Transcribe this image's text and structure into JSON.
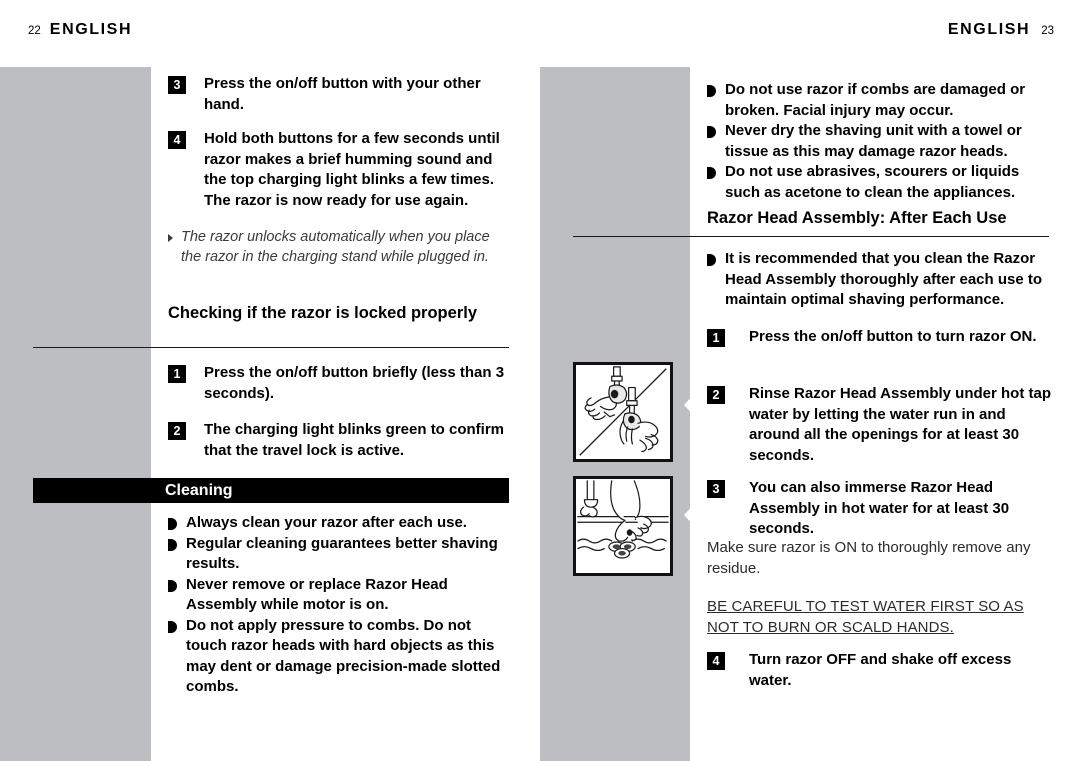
{
  "document": {
    "type": "product-manual-spread",
    "colors": {
      "page_background": "#ffffff",
      "side_column_gray": "#bcbec2",
      "section_bar": "#000000",
      "text": "#000000",
      "secondary_text": "#2b2b2b"
    }
  },
  "left_page": {
    "running_head": {
      "folio": "22",
      "language": "ENGLISH"
    },
    "steps_continued": [
      {
        "number": "3",
        "text": "Press the on/off button with your other hand."
      },
      {
        "number": "4",
        "text": "Hold both buttons for a few seconds until razor makes a brief humming sound and the top charging light blinks a few times. The razor is now ready for use again."
      }
    ],
    "note": "The razor unlocks automatically when you place the razor in the charging stand while plugged in.",
    "section_locked": {
      "heading": "Checking if the razor is locked properly",
      "steps": [
        {
          "number": "1",
          "text": "Press the on/off button briefly (less than 3 seconds)."
        },
        {
          "number": "2",
          "text": "The charging light blinks green to confirm that the travel lock is active."
        }
      ]
    },
    "section_cleaning": {
      "bar_title": "Cleaning",
      "bullets": [
        "Always clean your razor after each use.",
        "Regular cleaning guarantees better shaving results.",
        "Never remove or replace Razor Head Assembly while motor is on.",
        "Do not apply pressure to combs.  Do not touch razor heads with hard objects as this may dent or damage precision-made slotted combs."
      ]
    }
  },
  "right_page": {
    "running_head": {
      "folio": "23",
      "language": "ENGLISH"
    },
    "warning_bullets": [
      "Do not use razor if combs are damaged or broken. Facial injury may occur.",
      "Never dry the shaving unit with a towel or tissue as this may damage razor heads.",
      "Do not use abrasives, scourers or liquids such as acetone to clean the appliances."
    ],
    "section_head_assembly": {
      "heading": "Razor Head Assembly: After Each Use",
      "intro_bullets": [
        "It is recommended that you clean the Razor Head Assembly thoroughly after each use to maintain optimal shaving performance."
      ],
      "steps": [
        {
          "number": "1",
          "text": "Press the on/off button to turn razor ON."
        },
        {
          "number": "2",
          "text": "Rinse Razor Head Assembly under hot tap water by letting the water run in and around all the openings for at least 30 seconds."
        },
        {
          "number": "3",
          "text": "You can also immerse Razor Head Assembly in hot water for at least 30 seconds."
        },
        {
          "number": "4",
          "text": "Turn  razor OFF and shake off excess water."
        }
      ],
      "residue_note": "Make sure razor is ON to thoroughly remove any residue.",
      "caution_lines": [
        "BE CAREFUL TO TEST WATER FIRST SO AS ",
        "NOT TO BURN OR SCALD HANDS."
      ]
    },
    "figures": [
      {
        "name": "rinsing-razor-head-under-tap-illustration",
        "caption": ""
      },
      {
        "name": "immersing-razor-head-in-sink-illustration",
        "caption": ""
      }
    ]
  }
}
